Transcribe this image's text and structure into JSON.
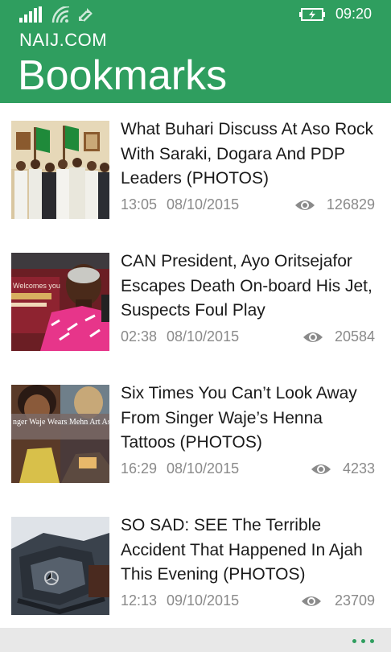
{
  "status_bar": {
    "time": "09:20",
    "icons": [
      "signal-strength-icon",
      "wifi-icon",
      "data-sync-icon",
      "battery-charging-icon"
    ]
  },
  "header": {
    "app_name": "NAIJ.COM",
    "page_title": "Bookmarks"
  },
  "articles": [
    {
      "headline": "What Buhari Discuss At Aso Rock With Saraki, Dogara And PDP Leaders (PHOTOS)",
      "time": "13:05",
      "date": "08/10/2015",
      "views": "126829",
      "thumbnail": "leaders-group-photo"
    },
    {
      "headline": "CAN President, Ayo Oritsejafor Escapes Death On-board His Jet, Suspects Foul Play",
      "time": "02:38",
      "date": "08/10/2015",
      "views": "20584",
      "thumbnail": "pastor-portrait-photo",
      "thumbnail_text": "Welcomes you"
    },
    {
      "headline": "Six Times You Can’t Look Away From Singer Waje’s Henna Tattoos (PHOTOS)",
      "time": "16:29",
      "date": "08/10/2015",
      "views": "4233",
      "thumbnail": "singer-collage-photo",
      "thumbnail_text": "nger Waje Wears Mehn Art As A Pro"
    },
    {
      "headline": "SO SAD: SEE The Terrible Accident That Happened In Ajah This Evening (PHOTOS)",
      "time": "12:13",
      "date": "09/10/2015",
      "views": "23709",
      "thumbnail": "car-accident-photo"
    }
  ],
  "app_bar": {
    "more_icon": "more-dots-icon"
  },
  "colors": {
    "accent": "#2f9e5f",
    "headline_text": "#1a1a1a",
    "meta_text": "#8a8a8a",
    "app_bar_bg": "#e8e8e8"
  }
}
